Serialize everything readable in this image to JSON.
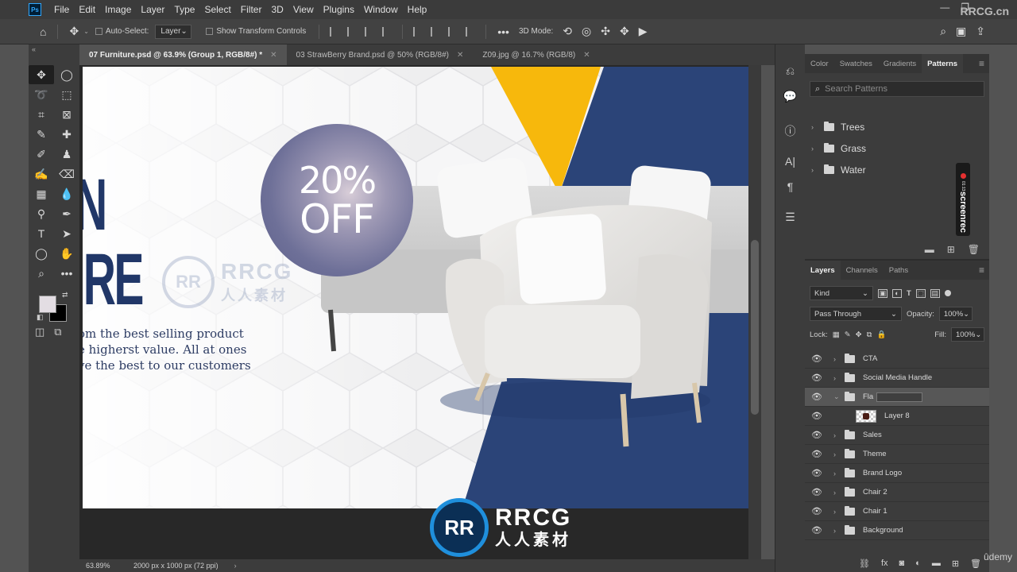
{
  "app": {
    "menu": [
      "File",
      "Edit",
      "Image",
      "Layer",
      "Type",
      "Select",
      "Filter",
      "3D",
      "View",
      "Plugins",
      "Window",
      "Help"
    ],
    "logo_text": "Ps",
    "watermark_top": "RRCG.cn"
  },
  "options_bar": {
    "auto_select_label": "Auto-Select:",
    "auto_select_value": "Layer",
    "transform_controls_label": "Show Transform Controls",
    "mode_3d_label": "3D Mode:"
  },
  "doc_tabs": [
    {
      "label": "07 Furniture.psd @ 63.9% (Group 1, RGB/8#) *",
      "active": true
    },
    {
      "label": "03 StrawBerry Brand.psd @ 50% (RGB/8#)",
      "active": false
    },
    {
      "label": "Z09.jpg @ 16.7% (RGB/8)",
      "active": false
    }
  ],
  "canvas": {
    "headline_line1": "N",
    "headline_line2": "URE",
    "tagline": [
      "om the best selling product",
      "e higherst value. All at ones",
      "ve the best to our customers"
    ],
    "badge_pct": "20%",
    "badge_off": "OFF",
    "colors": {
      "navy": "#2b4478",
      "yellow": "#f7b80c",
      "headline": "#213768"
    }
  },
  "status": {
    "zoom": "63.89%",
    "doc_info": "2000 px x 1000 px (72 ppi)"
  },
  "patterns_panel": {
    "tabs": [
      "Color",
      "Swatches",
      "Gradients",
      "Patterns"
    ],
    "active_tab": "Patterns",
    "search_placeholder": "Search Patterns",
    "folders": [
      "Trees",
      "Grass",
      "Water"
    ]
  },
  "layers_panel": {
    "tabs": [
      "Layers",
      "Channels",
      "Paths"
    ],
    "kind_label": "Kind",
    "blend_mode": "Pass Through",
    "opacity_label": "Opacity:",
    "opacity_value": "100%",
    "lock_label": "Lock:",
    "fill_label": "Fill:",
    "fill_value": "100%",
    "layers": [
      {
        "name": "CTA",
        "type": "group"
      },
      {
        "name": "Social Media Handle",
        "type": "group"
      },
      {
        "name": "Fla",
        "type": "group",
        "selected": true,
        "expanded": true
      },
      {
        "name": "Layer 8",
        "type": "layer"
      },
      {
        "name": "Sales",
        "type": "group"
      },
      {
        "name": "Theme",
        "type": "group"
      },
      {
        "name": "Brand Logo",
        "type": "group"
      },
      {
        "name": "Chair 2",
        "type": "group"
      },
      {
        "name": "Chair 1",
        "type": "group"
      },
      {
        "name": "Background",
        "type": "group"
      }
    ]
  },
  "overlays": {
    "screenrec_label": "screenrec",
    "screenrec_time": "01:13",
    "wm_title": "RRCG",
    "wm_sub": "人人素材",
    "udemy": "ûdemy"
  }
}
